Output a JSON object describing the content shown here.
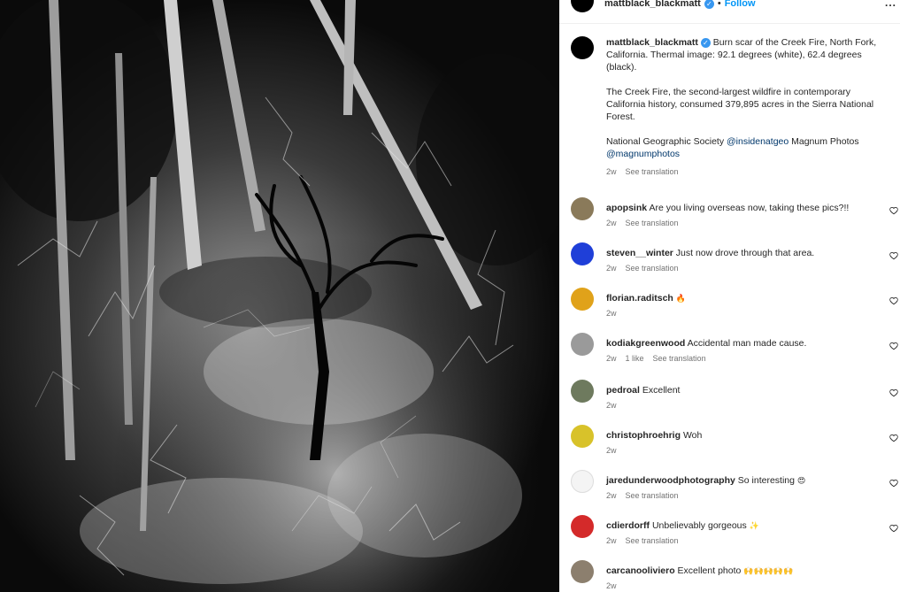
{
  "post": {
    "username": "mattblack_blackmatt",
    "follow_label": "Follow",
    "separator": "•",
    "more_label": "...",
    "verified_label": "✓"
  },
  "caption": {
    "username": "mattblack_blackmatt",
    "line1": "Burn scar of the Creek Fire, North Fork, California. Thermal image: 92.1 degrees (white), 62.4 degrees (black).",
    "line2": "The Creek Fire, the second-largest wildfire in contemporary California history, consumed 379,895 acres in the Sierra National Forest.",
    "line3_prefix": "National Geographic Society ",
    "mention1": "@insidenatgeo",
    "line3_mid": " Magnum Photos ",
    "mention2": "@magnumphotos",
    "age": "2w",
    "translate": "See translation"
  },
  "comments": [
    {
      "username": "apopsink",
      "text": "Are you living overseas now, taking these pics?!!",
      "emoji": "",
      "age": "2w",
      "likes": "",
      "translate": "See translation",
      "avatar_color": "#8a7a5a"
    },
    {
      "username": "steven__winter",
      "text": "Just now drove through that area.",
      "emoji": "",
      "age": "2w",
      "likes": "",
      "translate": "See translation",
      "avatar_color": "#1f3fd8"
    },
    {
      "username": "florian.raditsch",
      "text": "",
      "emoji": "🔥",
      "age": "2w",
      "likes": "",
      "translate": "",
      "avatar_color": "#e0a21a"
    },
    {
      "username": "kodiakgreenwood",
      "text": "Accidental man made cause.",
      "emoji": "",
      "age": "2w",
      "likes": "1 like",
      "translate": "See translation",
      "avatar_color": "#9a9a9a"
    },
    {
      "username": "pedroal",
      "text": "Excellent",
      "emoji": "",
      "age": "2w",
      "likes": "",
      "translate": "",
      "avatar_color": "#6e7a5e"
    },
    {
      "username": "christophroehrig",
      "text": "Woh",
      "emoji": "",
      "age": "2w",
      "likes": "",
      "translate": "",
      "avatar_color": "#d8c22a"
    },
    {
      "username": "jaredunderwoodphotography",
      "text": "So interesting",
      "emoji": "😍",
      "age": "2w",
      "likes": "",
      "translate": "See translation",
      "avatar_color": "#f4f4f4"
    },
    {
      "username": "cdierdorff",
      "text": "Unbelievably gorgeous",
      "emoji": "✨",
      "age": "2w",
      "likes": "",
      "translate": "See translation",
      "avatar_color": "#d42a2a"
    },
    {
      "username": "carcanooliviero",
      "text": "Excellent photo",
      "emoji": "🙌🙌🙌🙌🙌",
      "age": "2w",
      "likes": "",
      "translate": "",
      "avatar_color": "#8c7f6e"
    }
  ],
  "colors": {
    "link": "#00376b",
    "follow": "#0095f6",
    "meta": "#737373",
    "verified": "#3897f0"
  }
}
